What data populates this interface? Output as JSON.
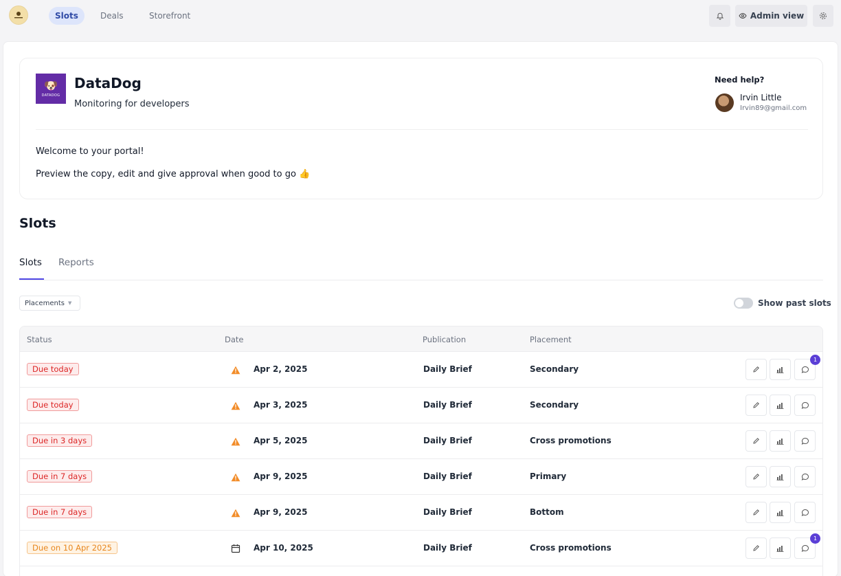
{
  "nav": {
    "items": [
      {
        "label": "Slots",
        "active": true
      },
      {
        "label": "Deals",
        "active": false
      },
      {
        "label": "Storefront",
        "active": false
      }
    ],
    "admin_label": "Admin view",
    "icons": {
      "logo": "brand-logo-icon",
      "bell": "bell-icon",
      "eye": "eye-icon",
      "settings": "gear-icon"
    }
  },
  "brand": {
    "name": "DataDog",
    "subtitle": "Monitoring for developers",
    "logo_color": "#632ca6",
    "logo_wordmark": "DATADOG"
  },
  "help": {
    "title": "Need help?",
    "contact_name": "Irvin Little",
    "contact_email": "Irvin89@gmail.com"
  },
  "welcome": {
    "line1": "Welcome to your portal!",
    "line2": "Preview the copy, edit and give approval when good to go 👍"
  },
  "section": {
    "title": "Slots"
  },
  "tabs": [
    {
      "label": "Slots",
      "active": true
    },
    {
      "label": "Reports",
      "active": false
    }
  ],
  "filters": {
    "placements_label": "Placements",
    "show_past_label": "Show past slots",
    "show_past_on": false
  },
  "table": {
    "columns": [
      "Status",
      "Date",
      "Publication",
      "Placement"
    ],
    "rows": [
      {
        "status": "Due today",
        "status_color": "red",
        "date_icon": "warning-icon",
        "date": "Apr 2, 2025",
        "publication": "Daily Brief",
        "placement": "Secondary",
        "comment_count": "1"
      },
      {
        "status": "Due today",
        "status_color": "red",
        "date_icon": "warning-icon",
        "date": "Apr 3, 2025",
        "publication": "Daily Brief",
        "placement": "Secondary",
        "comment_count": null
      },
      {
        "status": "Due in 3 days",
        "status_color": "red",
        "date_icon": "warning-icon",
        "date": "Apr 5, 2025",
        "publication": "Daily Brief",
        "placement": "Cross promotions",
        "comment_count": null
      },
      {
        "status": "Due in 7 days",
        "status_color": "red",
        "date_icon": "warning-icon",
        "date": "Apr 9, 2025",
        "publication": "Daily Brief",
        "placement": "Primary",
        "comment_count": null
      },
      {
        "status": "Due in 7 days",
        "status_color": "red",
        "date_icon": "warning-icon",
        "date": "Apr 9, 2025",
        "publication": "Daily Brief",
        "placement": "Bottom",
        "comment_count": null
      },
      {
        "status": "Due on 10 Apr 2025",
        "status_color": "orange",
        "date_icon": "calendar-icon",
        "date": "Apr 10, 2025",
        "publication": "Daily Brief",
        "placement": "Cross promotions",
        "comment_count": "1"
      }
    ]
  },
  "colors": {
    "accent": "#4f46e5",
    "badge": "#5b3fd6",
    "due_red": "#dc2626",
    "due_orange": "#e8871e",
    "warning": "#f28c28"
  }
}
